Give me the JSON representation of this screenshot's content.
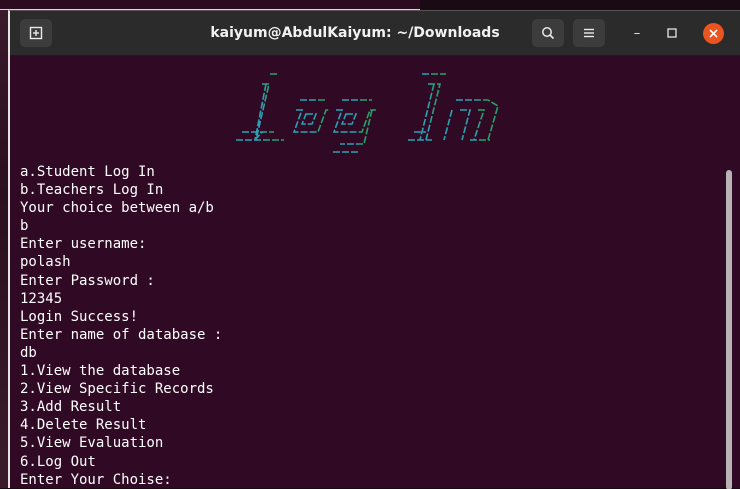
{
  "window": {
    "title": "kaiyum@AbdulKaiyum: ~/Downloads",
    "minimize_symbol": "–",
    "maximize_symbol": "☐"
  },
  "icons": {
    "new_tab": "new-tab-icon",
    "search": "search-icon",
    "menu": "hamburger-menu-icon",
    "close": "close-icon"
  },
  "colors": {
    "terminal_bg": "#300a24",
    "titlebar_bg": "#2b2b2b",
    "text": "#ffffff",
    "close_button": "#e95420",
    "logo_cyan": "#2aa1b3",
    "logo_green": "#26a269"
  },
  "banner": {
    "text": "Log In"
  },
  "terminal": {
    "lines": [
      "a.Student Log In",
      "b.Teachers Log In",
      "Your choice between a/b",
      "b",
      "Enter username:",
      "polash",
      "Enter Password :",
      "12345",
      "Login Success!",
      "Enter name of database :",
      "db",
      "1.View the database",
      "2.View Specific Records",
      "3.Add Result",
      "4.Delete Result",
      "5.View Evaluation",
      "6.Log Out",
      "Enter Your Choise:"
    ]
  }
}
